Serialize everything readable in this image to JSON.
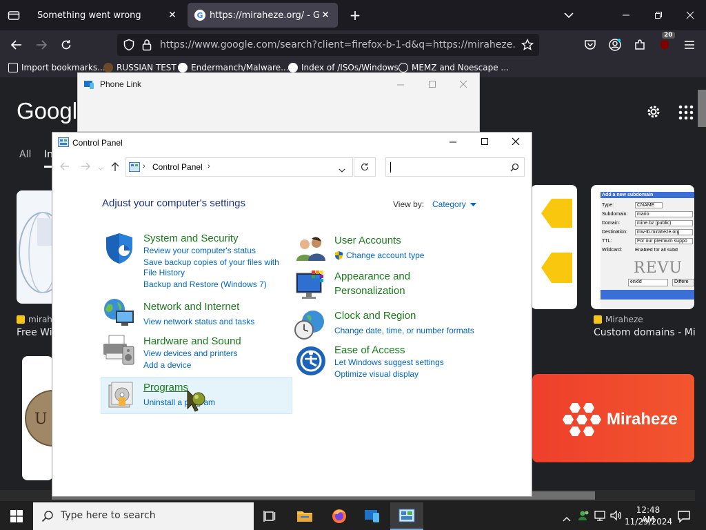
{
  "browser": {
    "tabs": [
      {
        "title": "Something went wrong"
      },
      {
        "title": "https://miraheze.org/ - Google"
      }
    ],
    "url": "https://www.google.com/search?client=firefox-b-1-d&q=https://miraheze.org/&udm",
    "extension_badge": "20",
    "bookmarks": [
      {
        "label": "Import bookmarks..."
      },
      {
        "label": "RUSSIAN TEST"
      },
      {
        "label": "Endermanch/Malware..."
      },
      {
        "label": "Index of /ISOs/Windows"
      },
      {
        "label": "MEMZ and Noescape ..."
      }
    ]
  },
  "google": {
    "logo": "Google",
    "tabs": {
      "all": "All",
      "images": "In"
    },
    "results": [
      {
        "site": "mirah",
        "title": "Free Wi"
      },
      {
        "site": "Miraheze",
        "title": "Custom domains - Mira"
      }
    ],
    "thumb_form": {
      "header": "Add a new subdomain",
      "rows": [
        {
          "label": "Type:",
          "value": "CNAME"
        },
        {
          "label": "Subdomain:",
          "value": "mario"
        },
        {
          "label": "Domain:",
          "value": "mine.bz (public)"
        },
        {
          "label": "Destination:",
          "value": "mw-lb.miraheze.org"
        },
        {
          "label": "TTL:",
          "value": "For our premium suppo"
        },
        {
          "label": "Wildcard:",
          "value": "Enabled for all subd"
        }
      ],
      "captcha": "REVU",
      "captcha_input": "enxld",
      "button": "Differe"
    },
    "banner_text": "Miraheze"
  },
  "phone_link": {
    "title": "Phone Link"
  },
  "control_panel": {
    "title": "Control Panel",
    "breadcrumb": "Control Panel",
    "heading": "Adjust your computer's settings",
    "view_by_label": "View by:",
    "view_by_value": "Category",
    "categories_left": [
      {
        "title": "System and Security",
        "links": [
          "Review your computer's status",
          "Save backup copies of your files with",
          "File History",
          "Backup and Restore (Windows 7)"
        ]
      },
      {
        "title": "Network and Internet",
        "links": [
          "View network status and tasks"
        ]
      },
      {
        "title": "Hardware and Sound",
        "links": [
          "View devices and printers",
          "Add a device"
        ]
      },
      {
        "title": "Programs",
        "links": [
          "Uninstall a program"
        ]
      }
    ],
    "categories_right": [
      {
        "title": "User Accounts",
        "links": [
          "Change account type"
        ]
      },
      {
        "title": "Appearance and",
        "title2": "Personalization",
        "links": []
      },
      {
        "title": "Clock and Region",
        "links": [
          "Change date, time, or number formats"
        ]
      },
      {
        "title": "Ease of Access",
        "links": [
          "Let Windows suggest settings",
          "Optimize visual display"
        ]
      }
    ]
  },
  "taskbar": {
    "search_placeholder": "Type here to search",
    "time": "12:48 AM",
    "date": "11/29/2024"
  },
  "colors": {
    "firefox_bg": "#1c1b22",
    "google_bg": "#202124",
    "cp_heading": "#1e3287",
    "cp_category": "#1a7b1a",
    "cp_link": "#0066cc"
  }
}
